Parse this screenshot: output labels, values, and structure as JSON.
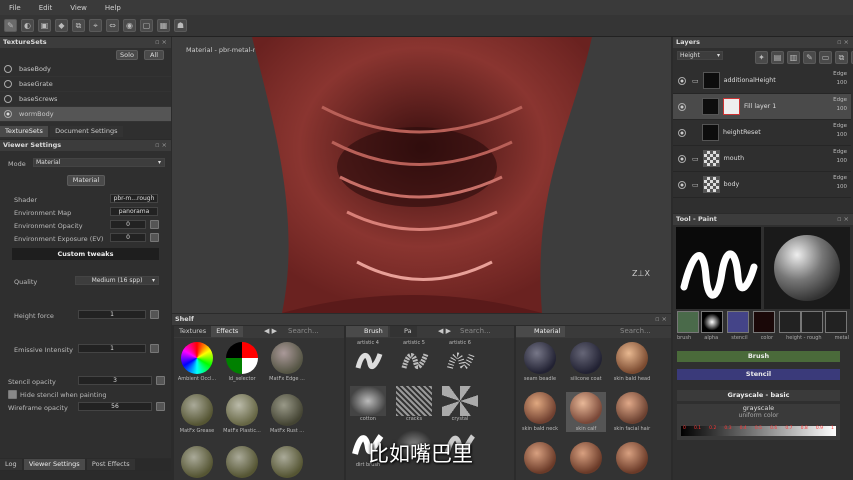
{
  "menu": [
    "File",
    "Edit",
    "View",
    "Help"
  ],
  "texturesets": {
    "title": "TextureSets",
    "solo": "Solo",
    "all": "All",
    "items": [
      "baseBody",
      "baseGrate",
      "baseScrews",
      "wormBody"
    ],
    "tabs": [
      "TextureSets",
      "Document Settings"
    ]
  },
  "viewer": {
    "title": "Viewer Settings",
    "mode_label": "Mode",
    "mode_value": "Material",
    "material_btn": "Material",
    "shader_label": "Shader",
    "shader_value": "pbr-m...rough",
    "envmap_label": "Environment Map",
    "envmap_value": "panorama",
    "envop_label": "Environment Opacity",
    "envop_value": "0",
    "envexp_label": "Environment Exposure (EV)",
    "envexp_value": "0",
    "custom": "Custom tweaks",
    "quality_label": "Quality",
    "quality_value": "Medium (16 spp)",
    "height_label": "Height force",
    "height_value": "1",
    "emissive_label": "Emissive Intensity",
    "emissive_value": "1",
    "stencil_label": "Stencil opacity",
    "stencil_value": "3",
    "hide_stencil": "Hide stencil when painting",
    "wire_label": "Wireframe opacity",
    "wire_value": "56"
  },
  "bottom_tabs": [
    "Log",
    "Viewer Settings",
    "Post Effects"
  ],
  "viewport": {
    "title": "Material - pbr-metal-rough",
    "subtitle": "比如嘴巴里",
    "colors": {
      "flesh": "#7a2a26",
      "bg": "#3d3d3d"
    }
  },
  "layers": {
    "title": "Layers",
    "channel": "Height",
    "items": [
      {
        "name": "additionalHeight",
        "blend": "Edge",
        "opacity": "100"
      },
      {
        "name": "Fill layer 1",
        "blend": "Edge",
        "opacity": "100"
      },
      {
        "name": "heightReset",
        "blend": "Edge",
        "opacity": "100"
      },
      {
        "name": "mouth",
        "blend": "Edge",
        "opacity": "100"
      },
      {
        "name": "body",
        "blend": "Edge",
        "opacity": "100"
      }
    ]
  },
  "tool": {
    "title": "Tool - Paint",
    "slots": [
      "brush",
      "alpha",
      "stencil",
      "color",
      "height - rough",
      "metal"
    ],
    "brush_section": "Brush",
    "stencil_section": "Stencil",
    "gray_section": "Grayscale - basic",
    "gray_label": "grayscale",
    "uniform": "uniform color",
    "scale": [
      "0",
      "0.1",
      "0.2",
      "0.3",
      "0.4",
      "0.5",
      "0.6",
      "0.7",
      "0.8",
      "0.9",
      "1"
    ]
  },
  "shelf": {
    "title": "Shelf",
    "tabs": [
      "Textures",
      "Effects"
    ],
    "search": "Search...",
    "brush_tab": "Brush",
    "particles_tab": "Pa",
    "material_tab": "Material",
    "effects": [
      "Ambient Occl...",
      "Id_selector",
      "MatFx Edge ...",
      "MatFx Grease",
      "MatFx Plastic...",
      "MatFx Rust ..."
    ],
    "brushes": [
      "artistic 4",
      "artistic 5",
      "artistic 6",
      "cotton",
      "cracks",
      "crystal",
      "dirt brush"
    ],
    "materials": [
      "seam beadle",
      "silicone coat",
      "skin bald head",
      "skin bald neck",
      "skin calf",
      "skin facial hair"
    ]
  }
}
